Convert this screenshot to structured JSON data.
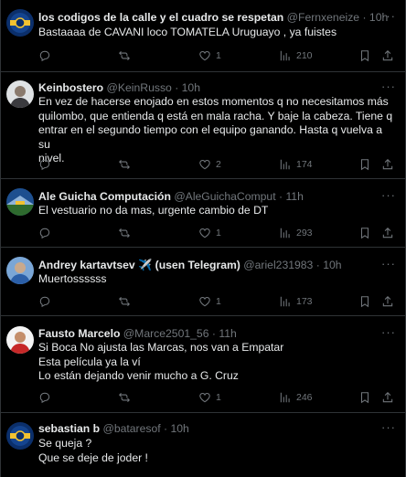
{
  "tweets": [
    {
      "name": "los codigos de la calle y el cuadro se respetan",
      "handle": "@Fernxeneize",
      "time": "10h",
      "lines": [
        "Bastaaaa de CAVANI loco TOMATELA Uruguayo , ya fuistes"
      ],
      "replies": "",
      "retweets": "",
      "likes": "1",
      "views": "210",
      "avatar": "blue-yellow-crest"
    },
    {
      "name": "Keinbostero",
      "handle": "@KeinRusso",
      "time": "10h",
      "lines": [
        "En vez de hacerse enojado en estos momentos q no necesitamos más",
        "quilombo, que entienda q está en mala racha. Y baje la cabeza. Tiene q",
        "entrar en el segundo tiempo con el equipo ganando. Hasta q vuelva a su",
        "nivel."
      ],
      "replies": "",
      "retweets": "",
      "likes": "2",
      "views": "174",
      "avatar": "person-gray"
    },
    {
      "name": "Ale Guicha Computación",
      "handle": "@AleGuichaComput",
      "time": "11h",
      "lines": [
        "El vestuario no da mas, urgente cambio de DT"
      ],
      "replies": "",
      "retweets": "",
      "likes": "1",
      "views": "293",
      "avatar": "stadium-blue"
    },
    {
      "name": "Andrey kartavtsev ✈️ (usen Telegram)",
      "handle": "@ariel231983",
      "time": "10h",
      "lines": [
        "Muertossssss"
      ],
      "replies": "",
      "retweets": "",
      "likes": "1",
      "views": "173",
      "avatar": "person-blue"
    },
    {
      "name": "Fausto Marcelo",
      "handle": "@Marce2501_56",
      "time": "11h",
      "lines": [
        "Si Boca No ajusta las Marcas, nos van a Empatar",
        "Esta película ya la ví",
        "Lo están dejando venir mucho a G. Cruz"
      ],
      "replies": "",
      "retweets": "",
      "likes": "1",
      "views": "246",
      "avatar": "person-white"
    },
    {
      "name": "sebastian b",
      "handle": "@bataresof",
      "time": "10h",
      "lines": [
        "Se queja ?",
        "Que se deje de joder !"
      ],
      "replies": "",
      "retweets": "",
      "likes": "",
      "views": "",
      "avatar": "blue-yellow-crest"
    }
  ],
  "icons": {
    "reply": "reply-icon",
    "retweet": "retweet-icon",
    "like": "like-icon",
    "views": "views-icon",
    "bookmark": "bookmark-icon",
    "share": "share-icon",
    "more": "more-icon"
  },
  "colors": {
    "background": "#000000",
    "text": "#e7e9ea",
    "secondary": "#71767b",
    "divider": "#2f3336"
  }
}
